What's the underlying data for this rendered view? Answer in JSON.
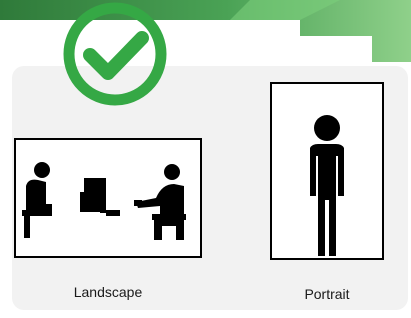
{
  "colors": {
    "banner_dark": "#2f7a3a",
    "banner_light": "#6cbf6e",
    "card_background": "#f2f2f2",
    "check_green": "#35a845",
    "ink": "#000000"
  },
  "options": [
    {
      "label": "Landscape",
      "icon": "office-meeting-scene-icon",
      "selected": true
    },
    {
      "label": "Portrait",
      "icon": "standing-person-icon",
      "selected": false
    }
  ],
  "selection_indicator": {
    "icon": "checkmark-icon"
  }
}
